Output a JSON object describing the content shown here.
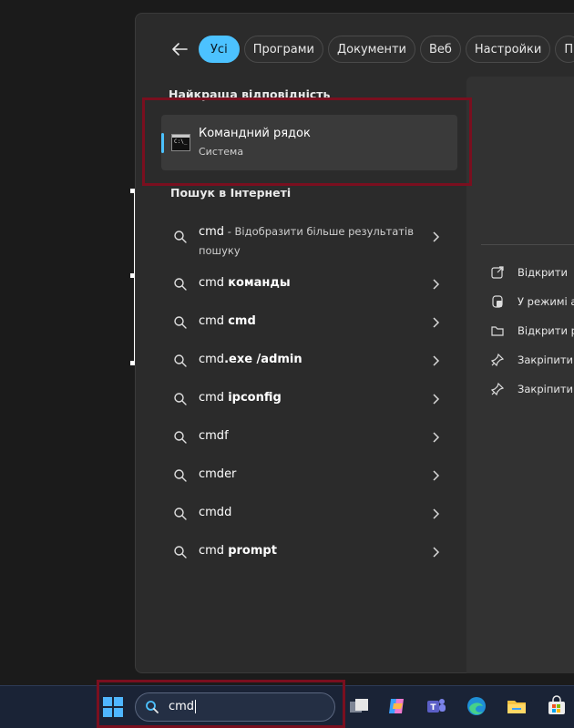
{
  "tabs": [
    {
      "label": "Усі",
      "active": true
    },
    {
      "label": "Програми"
    },
    {
      "label": "Документи"
    },
    {
      "label": "Веб"
    },
    {
      "label": "Настройки"
    },
    {
      "label": "П"
    }
  ],
  "best_match": {
    "heading": "Найкраща відповідність",
    "title": "Командний рядок",
    "subtitle": "Система",
    "icon": "command-prompt-icon"
  },
  "web": {
    "heading": "Пошук в Інтернеті",
    "first": {
      "query": "cmd",
      "suffix": " - Відобразити більше результатів пошуку"
    },
    "items": [
      {
        "prefix": "cmd ",
        "bold": "команды"
      },
      {
        "prefix": "cmd ",
        "bold": "cmd"
      },
      {
        "prefix": "cmd",
        "bold": ".exe /admin"
      },
      {
        "prefix": "cmd ",
        "bold": "ipconfig"
      },
      {
        "prefix": "cmdf",
        "bold": ""
      },
      {
        "prefix": "cmder",
        "bold": ""
      },
      {
        "prefix": "cmdd",
        "bold": ""
      },
      {
        "prefix": "cmd ",
        "bold": "prompt"
      }
    ]
  },
  "actions": [
    {
      "label": "Відкрити",
      "icon": "open-external-icon"
    },
    {
      "label": "У режимі а",
      "icon": "shield-admin-icon"
    },
    {
      "label": "Відкрити ре",
      "icon": "folder-icon"
    },
    {
      "label": "Закріпити в",
      "icon": "pin-icon"
    },
    {
      "label": "Закріпити н",
      "icon": "pin-icon"
    }
  ],
  "taskbar": {
    "search_value": "cmd",
    "apps": [
      "task-view-icon",
      "copilot-icon",
      "teams-icon",
      "edge-icon",
      "file-explorer-icon",
      "store-icon"
    ]
  },
  "colors": {
    "accent": "#4cc2ff",
    "highlight_box": "#7a0f1f",
    "panel": "#2b2b2b"
  }
}
